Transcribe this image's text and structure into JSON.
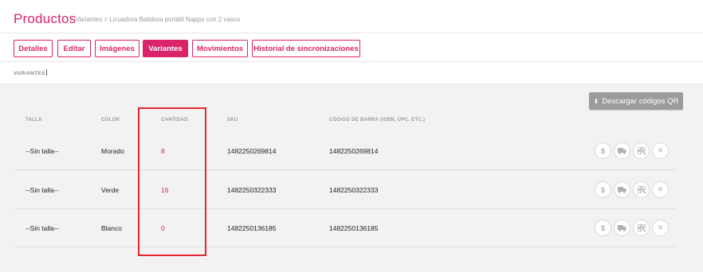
{
  "header": {
    "title": "Productos",
    "breadcrumb": "> Variantes  > Licuadora Batidora portátil Nappo con 2 vasos"
  },
  "tabs": [
    {
      "label": "Detalles",
      "active": false
    },
    {
      "label": "Editar",
      "active": false
    },
    {
      "label": "Imágenes",
      "active": false
    },
    {
      "label": "Variantes",
      "active": true
    },
    {
      "label": "Movimientos",
      "active": false
    },
    {
      "label": "Historial de sincronizaciones",
      "active": false
    }
  ],
  "section_label": "VARIANTES",
  "qr_button": {
    "label": "Descargar códigos QR",
    "icon": "download-icon"
  },
  "table": {
    "headers": [
      "TALLA",
      "COLOR",
      "CANTIDAD",
      "SKU",
      "CÓDIGO DE BARRA (ISBN, UPC, ETC.)"
    ],
    "rows": [
      {
        "talla": "--Sin talla--",
        "color": "Morado",
        "cantidad": "8",
        "sku": "1482250269814",
        "barcode": "1482250269814"
      },
      {
        "talla": "--Sin talla--",
        "color": "Verde",
        "cantidad": "16",
        "sku": "1482250322333",
        "barcode": "1482250322333"
      },
      {
        "talla": "--Sin talla--",
        "color": "Blanco",
        "cantidad": "0",
        "sku": "1482250136185",
        "barcode": "1482250136185"
      }
    ],
    "row_actions": [
      "dollar-icon",
      "truck-icon",
      "barcode-icon",
      "close-icon"
    ]
  },
  "colors": {
    "brand": "#d9246a",
    "highlight": "#e3262f",
    "button_gray": "#9b9b9b"
  }
}
